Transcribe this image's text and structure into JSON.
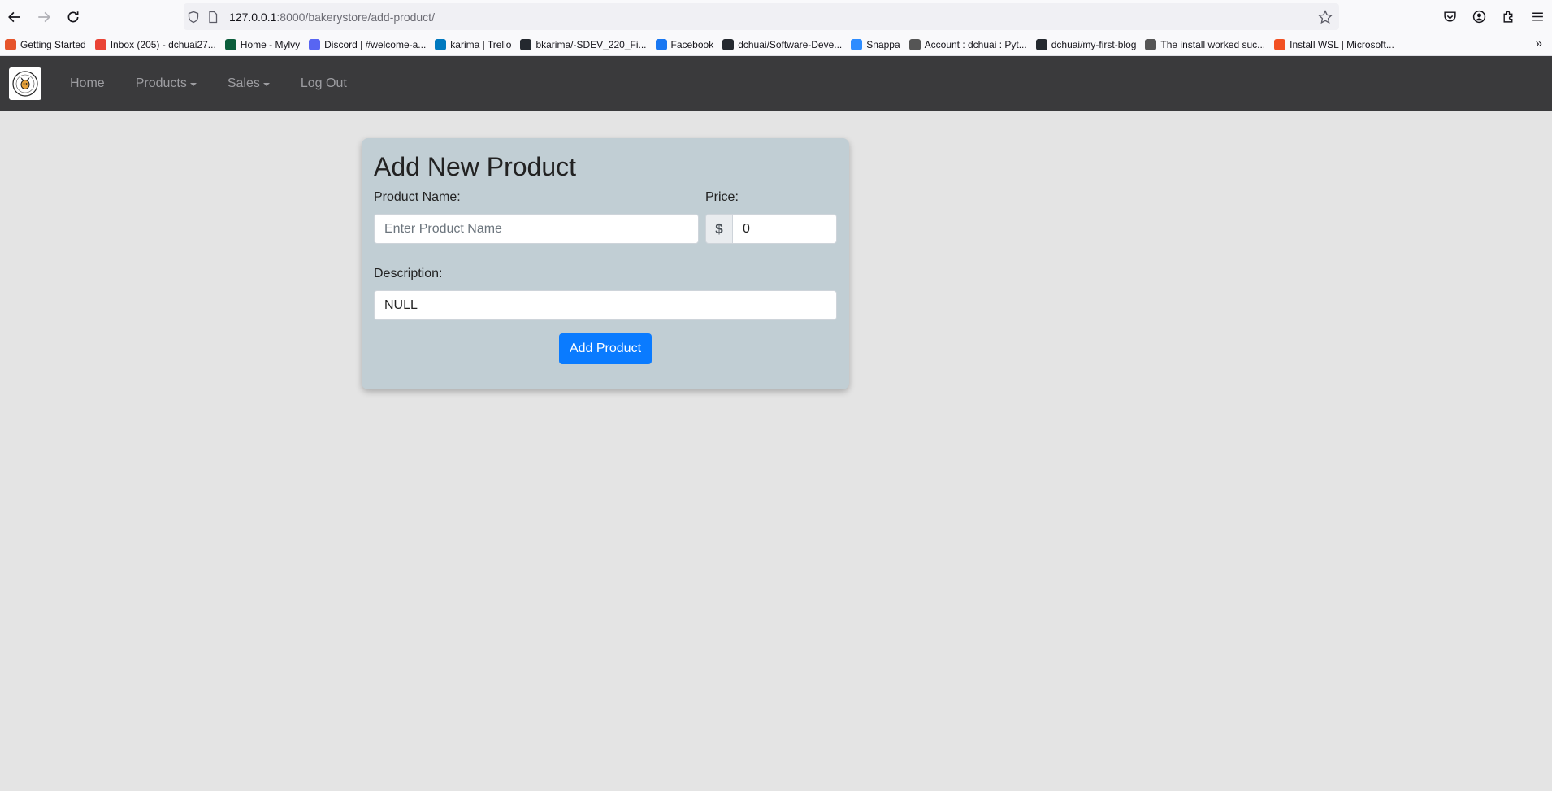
{
  "browser": {
    "url_host": "127.0.0.1",
    "url_rest": ":8000/bakerystore/add-product/",
    "bookmarks": [
      {
        "label": "Getting Started",
        "icon": "firefox-icon",
        "color": "#e6542b"
      },
      {
        "label": "Inbox (205) - dchuai27...",
        "icon": "gmail-icon",
        "color": "#ea4335"
      },
      {
        "label": "Home - Mylvy",
        "icon": "ivy-icon",
        "color": "#0b5d3b"
      },
      {
        "label": "Discord | #welcome-a...",
        "icon": "discord-icon",
        "color": "#5865f2"
      },
      {
        "label": "karima | Trello",
        "icon": "trello-icon",
        "color": "#0079bf"
      },
      {
        "label": "bkarima/-SDEV_220_Fi...",
        "icon": "github-icon",
        "color": "#24292f"
      },
      {
        "label": "Facebook",
        "icon": "facebook-icon",
        "color": "#1877f2"
      },
      {
        "label": "dchuai/Software-Deve...",
        "icon": "github-icon",
        "color": "#24292f"
      },
      {
        "label": "Snappa",
        "icon": "snappa-icon",
        "color": "#2d8cff"
      },
      {
        "label": "Account : dchuai : Pyt...",
        "icon": "pythonanywhere-icon",
        "color": "#555555"
      },
      {
        "label": "dchuai/my-first-blog",
        "icon": "github-icon",
        "color": "#24292f"
      },
      {
        "label": "The install worked suc...",
        "icon": "globe-icon",
        "color": "#555555"
      },
      {
        "label": "Install WSL | Microsoft...",
        "icon": "microsoft-icon",
        "color": "#f25022"
      }
    ]
  },
  "navbar": {
    "home": "Home",
    "products": "Products",
    "sales": "Sales",
    "logout": "Log Out"
  },
  "form": {
    "title": "Add New Product",
    "name_label": "Product Name:",
    "name_placeholder": "Enter Product Name",
    "price_label": "Price:",
    "currency_symbol": "$",
    "price_value": "0",
    "description_label": "Description:",
    "description_value": "NULL",
    "submit_label": "Add Product"
  },
  "colors": {
    "navbar_bg": "#3a3a3c",
    "card_bg": "#c1ced4",
    "primary": "#0a7bff"
  }
}
